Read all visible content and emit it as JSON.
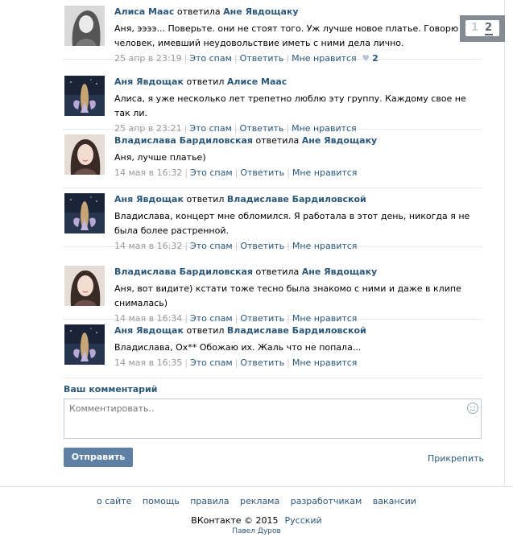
{
  "comments": [
    {
      "author": "Алиса Маас",
      "verb": "ответила",
      "reply_to": "Ане Явдощаку",
      "text": "Аня, ээээ... Поверьте. они не стоят того. Уж лучше новое платье. Говорю как человек, имевший неудовольствие иметь с ними дела лично.",
      "date": "25 апр в 23:19",
      "spam": "Это спам",
      "reply": "Ответить",
      "like": "Мне нравится",
      "likes": "2",
      "avatar_icon": "portrait-grey"
    },
    {
      "author": "Аня Явдощак",
      "verb": "ответил",
      "reply_to": "Алисе Маас",
      "text": "Алиса, я уже несколько лет трепетно люблю эту группу. Каждому свое не так ли.",
      "date": "25 апр в 23:21",
      "spam": "Это спам",
      "reply": "Ответить",
      "like": "Мне нравится",
      "avatar_icon": "night-figure"
    },
    {
      "author": "Владислава Бардиловская",
      "verb": "ответила",
      "reply_to": "Ане Явдощаку",
      "text": "Аня, лучше платье)",
      "date": "14 мая в 16:32",
      "spam": "Это спам",
      "reply": "Ответить",
      "like": "Мне нравится",
      "avatar_icon": "portrait-girl"
    },
    {
      "author": "Аня Явдощак",
      "verb": "ответил",
      "reply_to": "Владиславе Бардиловской",
      "text": "Владислава, концерт мне обломился. Я работала в этот день, никогда я не была более растренной.",
      "date": "14 мая в 16:32",
      "spam": "Это спам",
      "reply": "Ответить",
      "like": "Мне нравится",
      "avatar_icon": "night-figure"
    },
    {
      "author": "Владислава Бардиловская",
      "verb": "ответила",
      "reply_to": "Ане Явдощаку",
      "text": "Аня, вот видите) кстати тоже тесно была знакомо с ними и даже в клипе снималась)",
      "date": "14 мая в 16:34",
      "spam": "Это спам",
      "reply": "Ответить",
      "like": "Мне нравится",
      "avatar_icon": "portrait-girl"
    },
    {
      "author": "Аня Явдощак",
      "verb": "ответил",
      "reply_to": "Владиславе Бардиловской",
      "text": "Владислава, Ох** Обожаю их. Жаль что не попала...",
      "date": "14 мая в 16:35",
      "spam": "Это спам",
      "reply": "Ответить",
      "like": "Мне нравится",
      "avatar_icon": "night-figure"
    }
  ],
  "pager": {
    "page1": "1",
    "page2": "2",
    "current": "2"
  },
  "form": {
    "title": "Ваш комментарий",
    "placeholder": "Комментировать..",
    "send": "Отправить",
    "attach": "Прикрепить"
  },
  "footer": {
    "links": [
      "о сайте",
      "помощь",
      "правила",
      "реклама",
      "разработчикам",
      "вакансии"
    ],
    "copyright": "ВКонтакте © 2015",
    "language": "Русский",
    "author": "Павел Дуров"
  },
  "colors": {
    "link": "#2b587a",
    "button": "#5e80a4",
    "meta": "#999999"
  }
}
